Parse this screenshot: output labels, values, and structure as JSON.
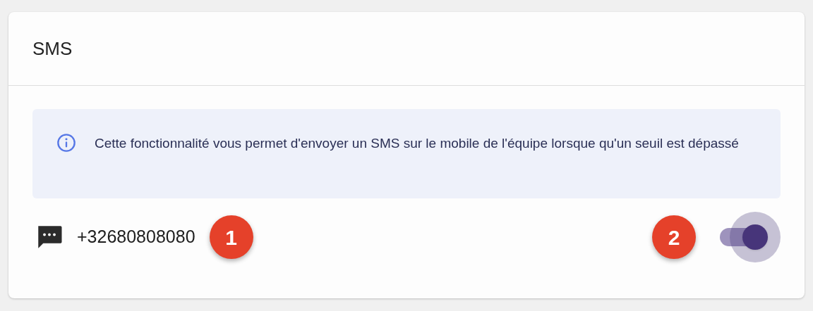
{
  "card": {
    "title": "SMS"
  },
  "info": {
    "text": "Cette fonctionnalité vous permet d'envoyer un SMS sur le mobile de l'équipe lorsque qu'un seuil est dépassé"
  },
  "contact": {
    "phone": "+32680808080",
    "badge": "1"
  },
  "toggle": {
    "on": true,
    "badge": "2"
  }
}
